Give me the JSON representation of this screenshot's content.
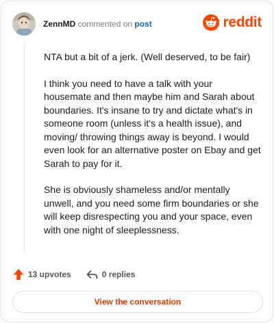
{
  "header": {
    "author": "ZennMD",
    "action": "commented on",
    "target": "post",
    "avatar_icon": "user-avatar",
    "brand_icon": "reddit-alien-icon",
    "brand_name": "reddit",
    "brand_color": "#ff4500"
  },
  "comment": {
    "paragraphs": [
      "NTA but a bit of a jerk. (Well deserved, to be fair)",
      "I think you need to have a talk with your housemate and then maybe him and Sarah about boundaries. It's insane to try and dictate what's in someone room (unless it's a health issue), and moving/ throwing things away is beyond. I would even look for an alternative poster on Ebay and get Sarah to pay for it.",
      "She is obviously shameless and/or mentally unwell, and you need some firm boundaries or she will keep disrespecting you and your space, even with one night of sleeplessness."
    ]
  },
  "footer": {
    "upvotes_label": "13 upvotes",
    "upvote_icon": "upvote-arrow-icon",
    "replies_label": "0 replies",
    "reply_icon": "reply-icon",
    "upvote_color": "#ff4500"
  },
  "cta": {
    "label": "View the conversation",
    "color": "#d93a00"
  }
}
